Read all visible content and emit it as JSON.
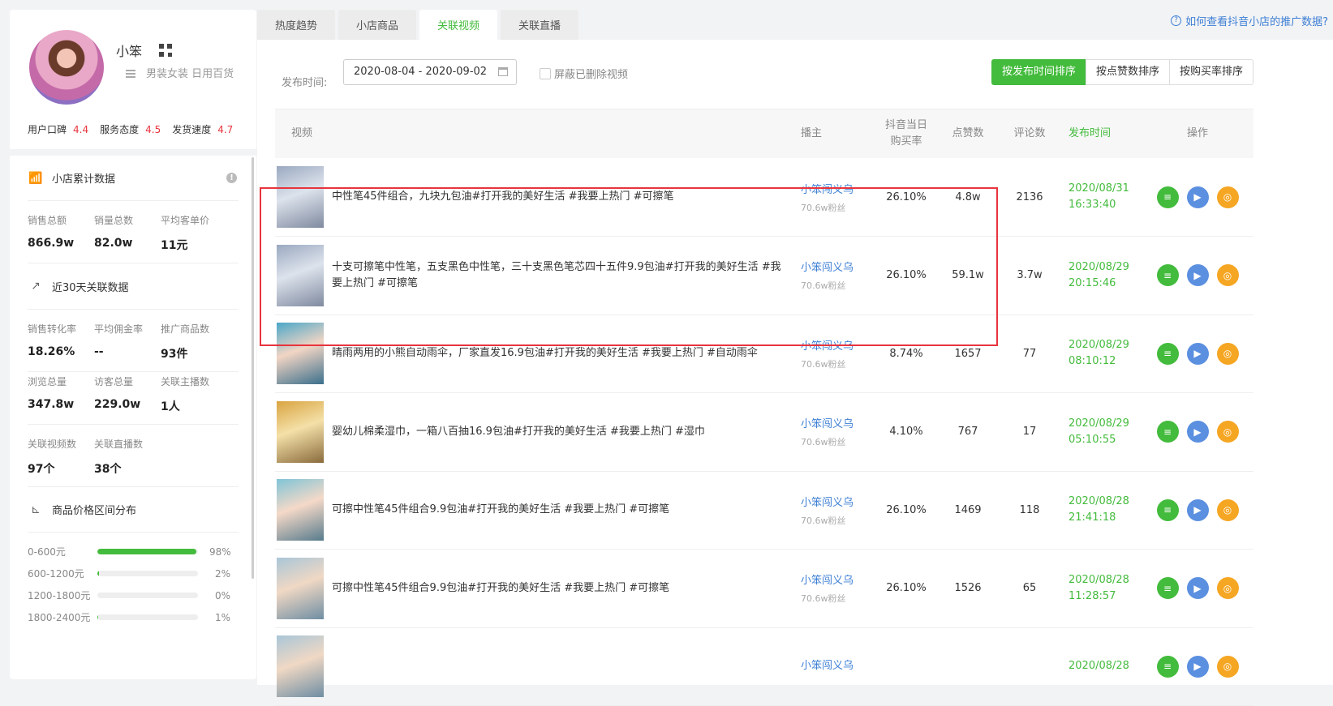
{
  "shop": {
    "name": "小笨",
    "category": "男装女装 日用百货",
    "ratings": [
      {
        "label": "用户口碑",
        "value": "4.4"
      },
      {
        "label": "服务态度",
        "value": "4.5"
      },
      {
        "label": "发货速度",
        "value": "4.7"
      }
    ]
  },
  "cumulative": {
    "title": "小店累计数据",
    "stats": [
      {
        "label": "销售总额",
        "value": "866.9w"
      },
      {
        "label": "销量总数",
        "value": "82.0w"
      },
      {
        "label": "平均客单价",
        "value": "11元"
      }
    ]
  },
  "recent": {
    "title": "近30天关联数据",
    "row1": [
      {
        "label": "销售转化率",
        "value": "18.26%"
      },
      {
        "label": "平均佣金率",
        "value": "--"
      },
      {
        "label": "推广商品数",
        "value": "93件"
      }
    ],
    "row2": [
      {
        "label": "浏览总量",
        "value": "347.8w"
      },
      {
        "label": "访客总量",
        "value": "229.0w"
      },
      {
        "label": "关联主播数",
        "value": "1人"
      }
    ],
    "row3": [
      {
        "label": "关联视频数",
        "value": "97个"
      },
      {
        "label": "关联直播数",
        "value": "38个"
      }
    ]
  },
  "price_dist": {
    "title": "商品价格区间分布",
    "rows": [
      {
        "range": "0-600元",
        "pct": "98%",
        "frac": 0.98
      },
      {
        "range": "600-1200元",
        "pct": "2%",
        "frac": 0.02
      },
      {
        "range": "1200-1800元",
        "pct": "0%",
        "frac": 0
      },
      {
        "range": "1800-2400元",
        "pct": "1%",
        "frac": 0.01
      }
    ]
  },
  "tabs": [
    "热度趋势",
    "小店商品",
    "关联视频",
    "关联直播"
  ],
  "help_link": "如何查看抖音小店的推广数据?",
  "filter": {
    "label": "发布时间:",
    "date_range": "2020-08-04 - 2020-09-02",
    "checkbox": "屏蔽已删除视频",
    "sorts": [
      "按发布时间排序",
      "按点赞数排序",
      "按购买率排序"
    ]
  },
  "columns": {
    "video": "视频",
    "host": "播主",
    "rate1": "抖音当日",
    "rate2": "购买率",
    "likes": "点赞数",
    "comments": "评论数",
    "time": "发布时间",
    "ops": "操作"
  },
  "rows": [
    {
      "title": "中性笔45件组合，九块九包油#打开我的美好生活 #我要上热门 #可擦笔",
      "host": "小笨闯义乌",
      "fans": "70.6w粉丝",
      "rate": "26.10%",
      "likes": "4.8w",
      "comments": "2136",
      "date": "2020/08/31",
      "clock": "16:33:40"
    },
    {
      "title": "十支可擦笔中性笔，五支黑色中性笔，三十支黑色笔芯四十五件9.9包油#打开我的美好生活 #我要上热门 #可擦笔",
      "host": "小笨闯义乌",
      "fans": "70.6w粉丝",
      "rate": "26.10%",
      "likes": "59.1w",
      "comments": "3.7w",
      "date": "2020/08/29",
      "clock": "20:15:46"
    },
    {
      "title": "晴雨两用的小熊自动雨伞，厂家直发16.9包油#打开我的美好生活 #我要上热门 #自动雨伞",
      "host": "小笨闯义乌",
      "fans": "70.6w粉丝",
      "rate": "8.74%",
      "likes": "1657",
      "comments": "77",
      "date": "2020/08/29",
      "clock": "08:10:12"
    },
    {
      "title": "婴幼儿棉柔湿巾，一箱八百抽16.9包油#打开我的美好生活 #我要上热门 #湿巾",
      "host": "小笨闯义乌",
      "fans": "70.6w粉丝",
      "rate": "4.10%",
      "likes": "767",
      "comments": "17",
      "date": "2020/08/29",
      "clock": "05:10:55"
    },
    {
      "title": "可擦中性笔45件组合9.9包油#打开我的美好生活 #我要上热门 #可擦笔",
      "host": "小笨闯义乌",
      "fans": "70.6w粉丝",
      "rate": "26.10%",
      "likes": "1469",
      "comments": "118",
      "date": "2020/08/28",
      "clock": "21:41:18"
    },
    {
      "title": "可擦中性笔45件组合9.9包油#打开我的美好生活 #我要上热门 #可擦笔",
      "host": "小笨闯义乌",
      "fans": "70.6w粉丝",
      "rate": "26.10%",
      "likes": "1526",
      "comments": "65",
      "date": "2020/08/28",
      "clock": "11:28:57"
    },
    {
      "title": "",
      "host": "小笨闯义乌",
      "fans": "",
      "rate": "",
      "likes": "",
      "comments": "",
      "date": "2020/08/28",
      "clock": ""
    }
  ],
  "colors": {
    "accent": "#43bb3c",
    "link": "#3d7fd4",
    "rating": "#e8343d",
    "highlight": "#e8343d"
  }
}
